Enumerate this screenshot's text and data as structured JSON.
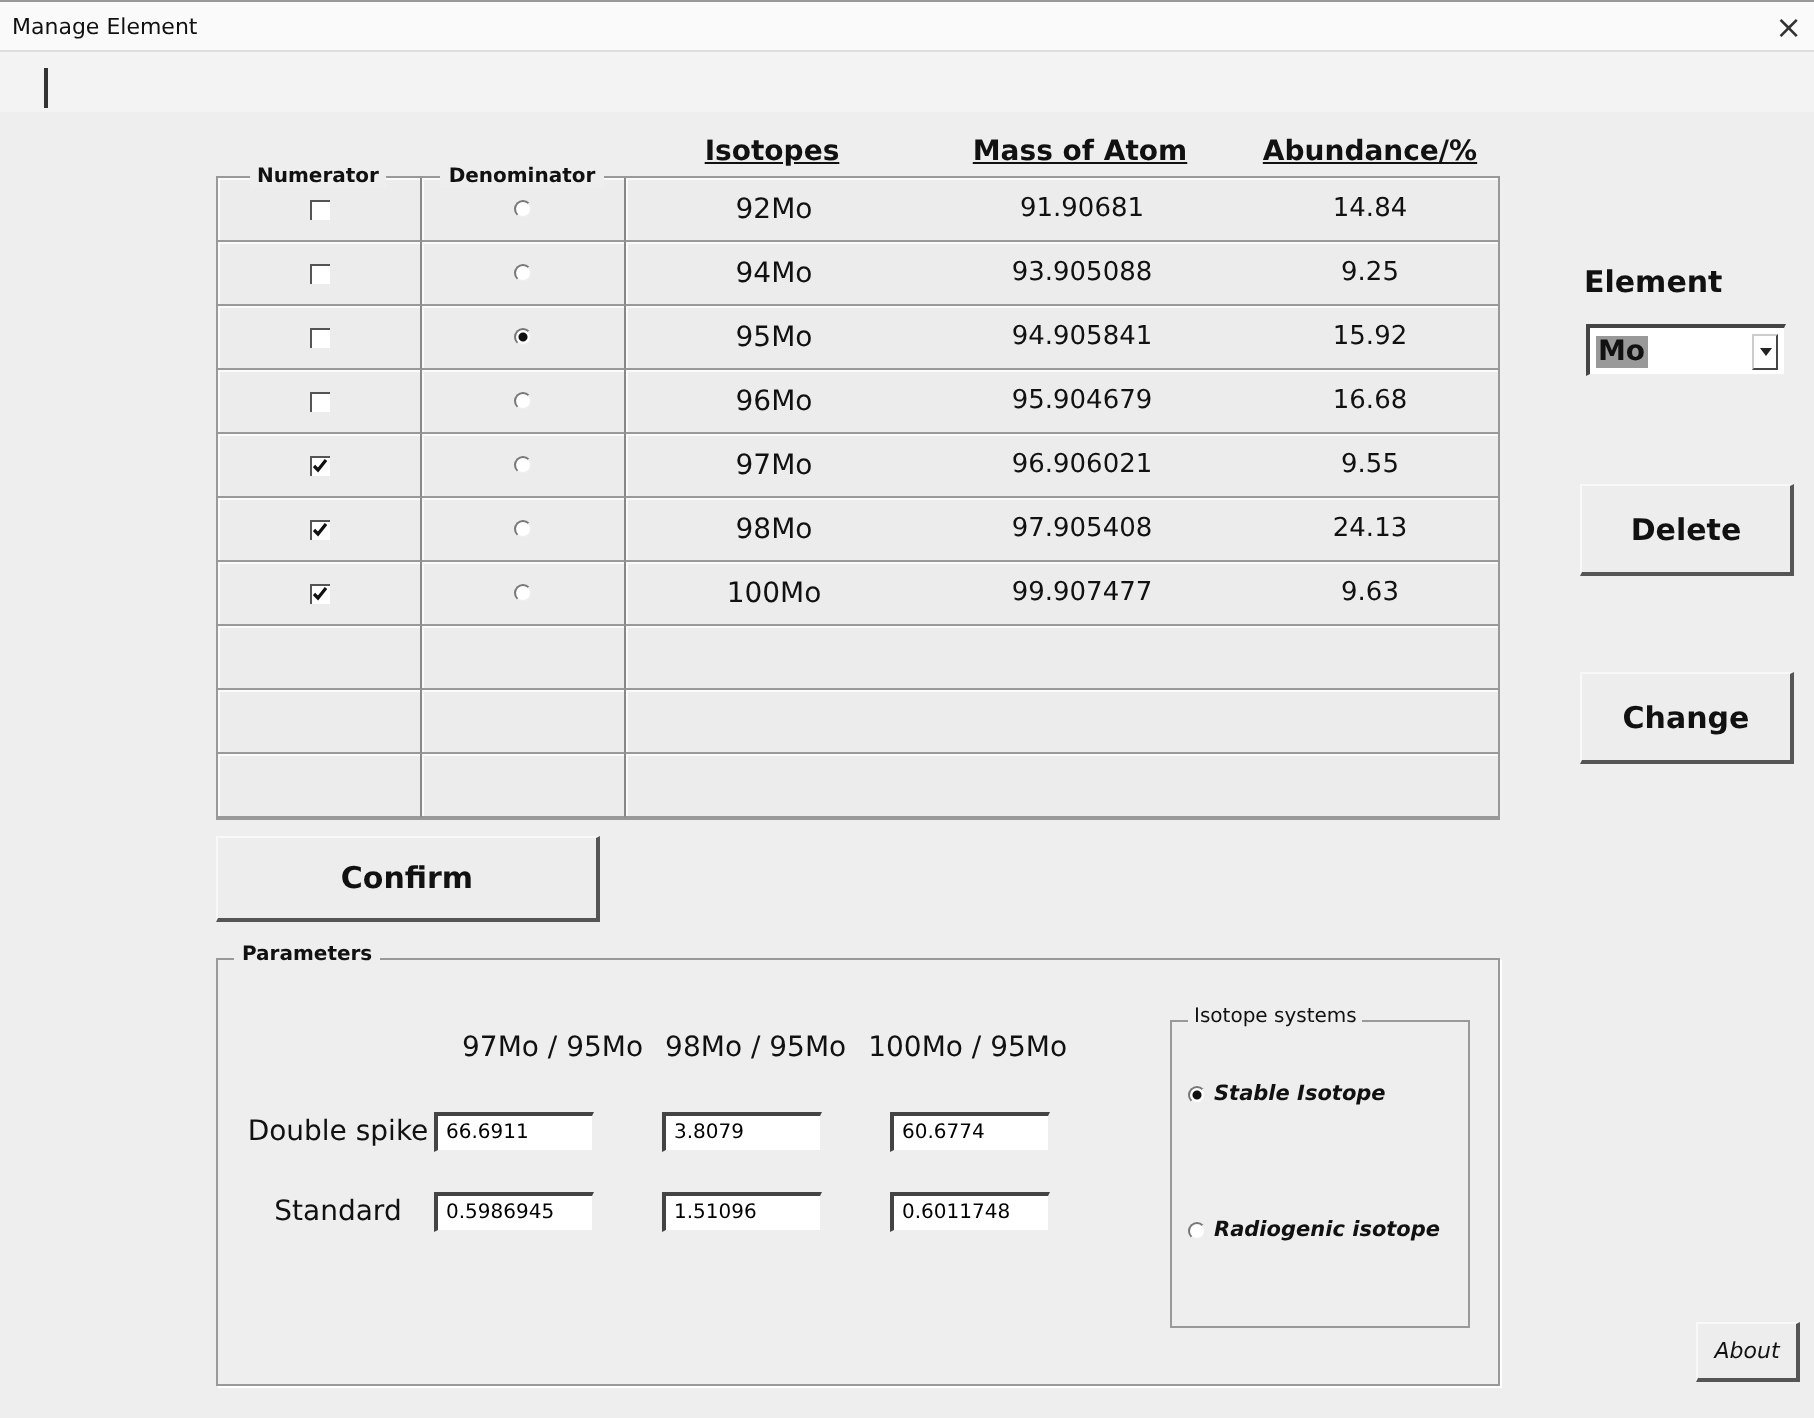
{
  "window": {
    "title": "Manage Element",
    "close": "×"
  },
  "table": {
    "numerator_label": "Numerator",
    "denominator_label": "Denominator",
    "columns": [
      "Isotopes",
      "Mass of Atom",
      "Abundance/%"
    ],
    "rows": [
      {
        "numerator": false,
        "denominator": false,
        "isotope": "92Mo",
        "mass": "91.90681",
        "abundance": "14.84"
      },
      {
        "numerator": false,
        "denominator": false,
        "isotope": "94Mo",
        "mass": "93.905088",
        "abundance": "9.25"
      },
      {
        "numerator": false,
        "denominator": true,
        "isotope": "95Mo",
        "mass": "94.905841",
        "abundance": "15.92"
      },
      {
        "numerator": false,
        "denominator": false,
        "isotope": "96Mo",
        "mass": "95.904679",
        "abundance": "16.68"
      },
      {
        "numerator": true,
        "denominator": false,
        "isotope": "97Mo",
        "mass": "96.906021",
        "abundance": "9.55"
      },
      {
        "numerator": true,
        "denominator": false,
        "isotope": "98Mo",
        "mass": "97.905408",
        "abundance": "24.13"
      },
      {
        "numerator": true,
        "denominator": false,
        "isotope": "100Mo",
        "mass": "99.907477",
        "abundance": "9.63"
      }
    ]
  },
  "confirm_button": "Confirm",
  "element": {
    "label": "Element",
    "value": "Mo"
  },
  "delete_button": "Delete",
  "change_button": "Change",
  "parameters": {
    "title": "Parameters",
    "ratios": [
      "97Mo / 95Mo",
      "98Mo / 95Mo",
      "100Mo / 95Mo"
    ],
    "rows": [
      {
        "label": "Double spike",
        "values": [
          "66.6911",
          "3.8079",
          "60.6774"
        ]
      },
      {
        "label": "Standard",
        "values": [
          "0.5986945",
          "1.51096",
          "0.6011748"
        ]
      }
    ]
  },
  "isotope_systems": {
    "title": "Isotope systems",
    "options": [
      {
        "label": "Stable Isotope",
        "selected": true
      },
      {
        "label": "Radiogenic isotope",
        "selected": false
      }
    ]
  },
  "about_button": "About"
}
